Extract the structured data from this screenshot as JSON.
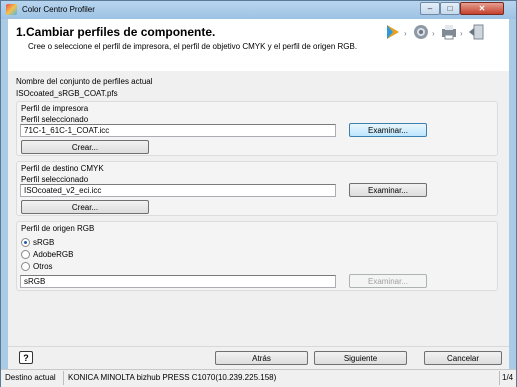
{
  "window": {
    "title": "Color Centro Profiler",
    "close_glyph": "✕",
    "minimize_glyph": "–",
    "maximize_glyph": "□"
  },
  "header": {
    "title": "1.Cambiar perfiles de componente.",
    "description": "Cree o seleccione el perfil de impresora, el perfil de objetivo CMYK y el perfil de origen RGB.",
    "step_icons": [
      "play-icon",
      "gear-icon",
      "printer-icon",
      "export-icon"
    ],
    "arrow": "›"
  },
  "profile_set": {
    "label": "Nombre del conjunto de perfiles actual",
    "value": "ISOcoated_sRGB_COAT.pfs"
  },
  "printer_profile": {
    "group_label": "Perfil de impresora",
    "selected_label": "Perfil seleccionado",
    "selected_value": "71C-1_61C-1_COAT.icc",
    "browse_button": "Examinar...",
    "create_button": "Crear..."
  },
  "cmyk_profile": {
    "group_label": "Perfil de destino CMYK",
    "selected_label": "Perfil seleccionado",
    "selected_value": "ISOcoated_v2_eci.icc",
    "browse_button": "Examinar...",
    "create_button": "Crear..."
  },
  "rgb_profile": {
    "group_label": "Perfil de origen RGB",
    "options": [
      "sRGB",
      "AdobeRGB",
      "Otros"
    ],
    "selected_index": 0,
    "value": "sRGB",
    "browse_button": "Examinar..."
  },
  "footer": {
    "help": "?",
    "back": "Atrás",
    "next": "Siguiente",
    "cancel": "Cancelar"
  },
  "statusbar": {
    "label": "Destino actual",
    "device": "KONICA MINOLTA bizhub PRESS C1070(10.239.225.158)",
    "page": "1/4"
  },
  "colors": {
    "titlebar": "#aacbe6",
    "accent": "#3c7fb1"
  }
}
